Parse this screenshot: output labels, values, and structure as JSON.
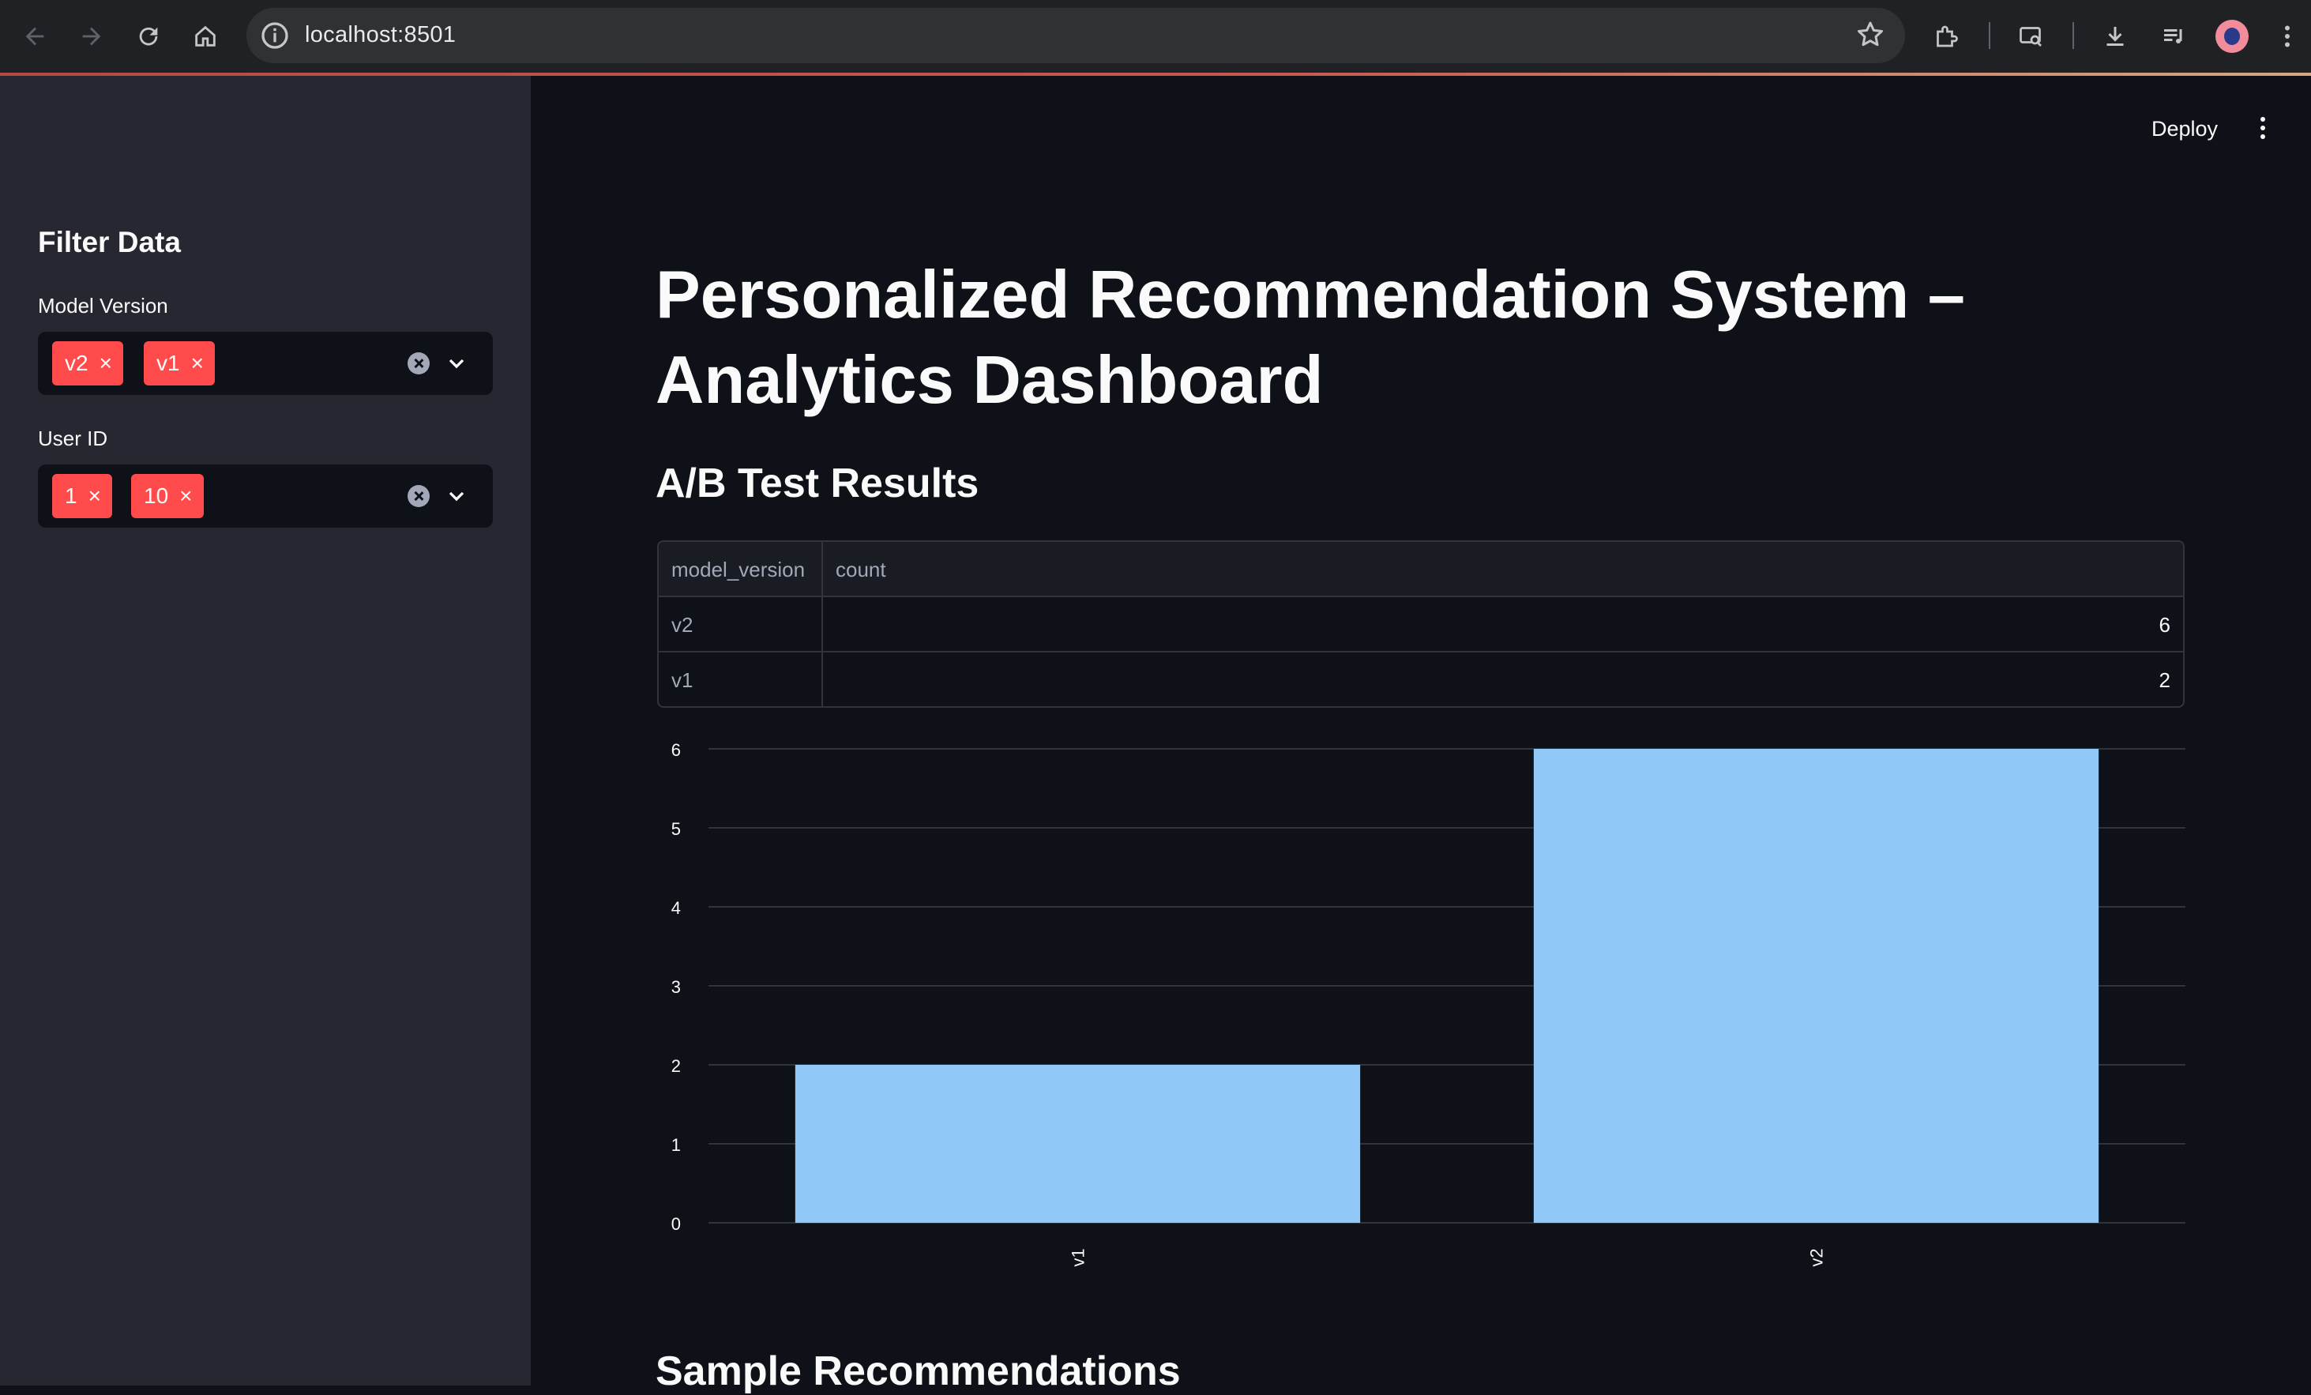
{
  "browser": {
    "url": "localhost:8501"
  },
  "sidebar": {
    "title": "Filter Data",
    "model_version": {
      "label": "Model Version",
      "selected": [
        "v2",
        "v1"
      ]
    },
    "user_id": {
      "label": "User ID",
      "selected": [
        "1",
        "10"
      ]
    }
  },
  "header": {
    "deploy_label": "Deploy"
  },
  "main": {
    "title": "Personalized Recommendation System – Analytics Dashboard",
    "ab_heading": "A/B Test Results",
    "table": {
      "columns": [
        "model_version",
        "count"
      ],
      "rows": [
        [
          "v2",
          "6"
        ],
        [
          "v1",
          "2"
        ]
      ]
    },
    "sample_heading": "Sample Recommendations"
  },
  "chart_data": {
    "type": "bar",
    "categories": [
      "v1",
      "v2"
    ],
    "values": [
      2,
      6
    ],
    "ylim": [
      0,
      6
    ],
    "yticks": [
      0,
      1,
      2,
      3,
      4,
      5,
      6
    ],
    "bar_color": "#90c8f8",
    "grid": true,
    "title": "",
    "xlabel": "",
    "ylabel": ""
  },
  "colors": {
    "background": "#0e1117",
    "sidebar": "#262730",
    "accent": "#ff4b4b"
  }
}
